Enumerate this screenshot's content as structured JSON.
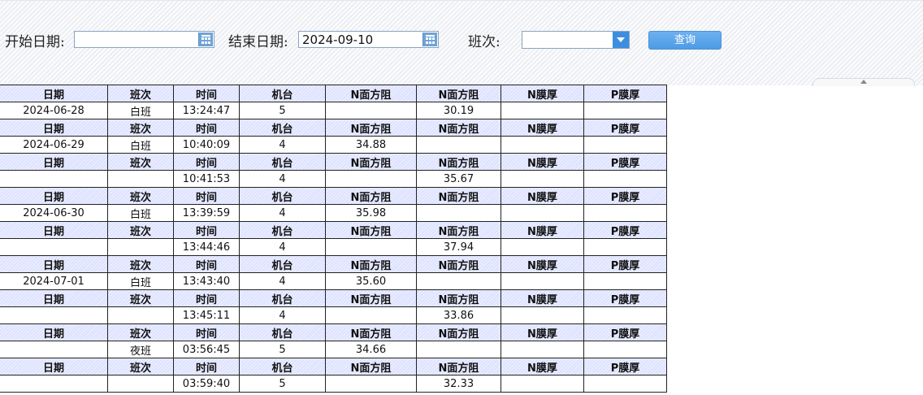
{
  "filters": {
    "start_date_label": "开始日期:",
    "start_date_value": "",
    "end_date_label": "结束日期:",
    "end_date_value": "2024-09-10",
    "shift_label": "班次:",
    "shift_value": "",
    "query_button": "查询"
  },
  "table": {
    "headers": {
      "date": "日期",
      "shift": "班次",
      "time": "时间",
      "machine": "机台",
      "n_sheet_res_1": "N面方阻",
      "n_sheet_res_2": "N面方阻",
      "n_film": "N膜厚",
      "p_film": "P膜厚"
    },
    "rows": [
      {
        "date": "2024-06-28",
        "shift": "白班",
        "time": "13:24:47",
        "machine": "5",
        "n1": "",
        "n2": "30.19",
        "nfilm": "",
        "pfilm": ""
      },
      {
        "date": "2024-06-29",
        "shift": "白班",
        "time": "10:40:09",
        "machine": "4",
        "n1": "34.88",
        "n2": "",
        "nfilm": "",
        "pfilm": ""
      },
      {
        "date": "",
        "shift": "",
        "time": "10:41:53",
        "machine": "4",
        "n1": "",
        "n2": "35.67",
        "nfilm": "",
        "pfilm": ""
      },
      {
        "date": "2024-06-30",
        "shift": "白班",
        "time": "13:39:59",
        "machine": "4",
        "n1": "35.98",
        "n2": "",
        "nfilm": "",
        "pfilm": ""
      },
      {
        "date": "",
        "shift": "",
        "time": "13:44:46",
        "machine": "4",
        "n1": "",
        "n2": "37.94",
        "nfilm": "",
        "pfilm": ""
      },
      {
        "date": "2024-07-01",
        "shift": "白班",
        "time": "13:43:40",
        "machine": "4",
        "n1": "35.60",
        "n2": "",
        "nfilm": "",
        "pfilm": ""
      },
      {
        "date": "",
        "shift": "",
        "time": "13:45:11",
        "machine": "4",
        "n1": "",
        "n2": "33.86",
        "nfilm": "",
        "pfilm": ""
      },
      {
        "date": "",
        "shift": "夜班",
        "time": "03:56:45",
        "machine": "5",
        "n1": "34.66",
        "n2": "",
        "nfilm": "",
        "pfilm": ""
      },
      {
        "date": "",
        "shift": "",
        "time": "03:59:40",
        "machine": "5",
        "n1": "",
        "n2": "32.33",
        "nfilm": "",
        "pfilm": ""
      }
    ]
  },
  "colors": {
    "header_bg": "#dde2ff",
    "accent": "#4e9be6"
  }
}
